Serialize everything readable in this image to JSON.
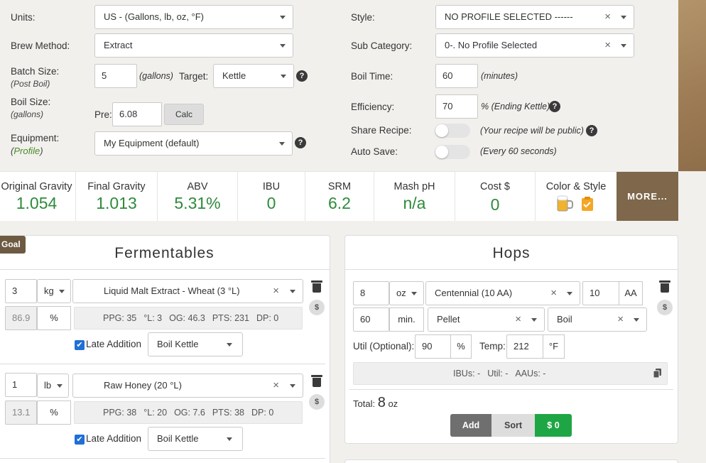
{
  "settings": {
    "units_label": "Units:",
    "units_value": "US - (Gallons, lb, oz, °F)",
    "brew_method_label": "Brew Method:",
    "brew_method_value": "Extract",
    "batch_size_label": "Batch Size:",
    "batch_size_sub": "(Post Boil)",
    "batch_size_value": "5",
    "batch_size_unit": "(gallons)",
    "target_label": "Target:",
    "target_value": "Kettle",
    "boil_size_label": "Boil Size:",
    "boil_size_sub": "(gallons)",
    "pre_label": "Pre:",
    "pre_value": "6.08",
    "calc_label": "Calc",
    "equipment_label": "Equipment:",
    "equipment_sub_open": "(",
    "equipment_sub_link": "Profile",
    "equipment_sub_close": ")",
    "equipment_value": "My Equipment (default)",
    "style_label": "Style:",
    "style_value": "NO PROFILE SELECTED ------",
    "subcat_label": "Sub Category:",
    "subcat_value": "0-. No Profile Selected",
    "boil_time_label": "Boil Time:",
    "boil_time_value": "60",
    "boil_time_unit": "(minutes)",
    "efficiency_label": "Efficiency:",
    "efficiency_value": "70",
    "efficiency_unit": "% (Ending Kettle)",
    "share_label": "Share Recipe:",
    "share_note": "(Your recipe will be public)",
    "autosave_label": "Auto Save:",
    "autosave_note": "(Every 60 seconds)",
    "help_glyph": "?",
    "clear_glyph": "×"
  },
  "stats": {
    "og_label": "Original Gravity",
    "og_value": "1.054",
    "fg_label": "Final Gravity",
    "fg_value": "1.013",
    "abv_label": "ABV",
    "abv_value": "5.31%",
    "ibu_label": "IBU",
    "ibu_value": "0",
    "srm_label": "SRM",
    "srm_value": "6.2",
    "ph_label": "Mash pH",
    "ph_value": "n/a",
    "cost_label": "Cost $",
    "cost_value": "0",
    "color_label": "Color & Style",
    "more_label": "MORE..."
  },
  "fermentables": {
    "goal_label": "Goal",
    "title": "Fermentables",
    "dollar_glyph": "$",
    "percent_glyph": "%",
    "check_glyph": "✔",
    "rows": [
      {
        "amount": "3",
        "unit": "kg",
        "name": "Liquid Malt Extract - Wheat (3 °L)",
        "percent": "86.9",
        "ppg": "PPG: 35",
        "lov": "°L: 3",
        "og": "OG: 46.3",
        "pts": "PTS: 231",
        "dp": "DP: 0",
        "late_label": "Late Addition",
        "stage": "Boil Kettle"
      },
      {
        "amount": "1",
        "unit": "lb",
        "name": "Raw Honey (20 °L)",
        "percent": "13.1",
        "ppg": "PPG: 38",
        "lov": "°L: 20",
        "og": "OG: 7.6",
        "pts": "PTS: 38",
        "dp": "DP: 0",
        "late_label": "Late Addition",
        "stage": "Boil Kettle"
      }
    ]
  },
  "hops": {
    "title": "Hops",
    "amount": "8",
    "unit": "oz",
    "variety": "Centennial (10 AA)",
    "aa_value": "10",
    "aa_label": "AA",
    "time": "60",
    "time_unit": "min.",
    "form": "Pellet",
    "use": "Boil",
    "util_label": "Util (Optional):",
    "util_value": "90",
    "util_unit": "%",
    "temp_label": "Temp:",
    "temp_value": "212",
    "temp_unit": "°F",
    "ibus": "IBUs: -",
    "util": "Util: -",
    "aaus": "AAUs: -",
    "total_label": "Total:",
    "total_value": "8",
    "total_unit": "oz",
    "add_label": "Add",
    "sort_label": "Sort",
    "cost_label": "$ 0"
  }
}
